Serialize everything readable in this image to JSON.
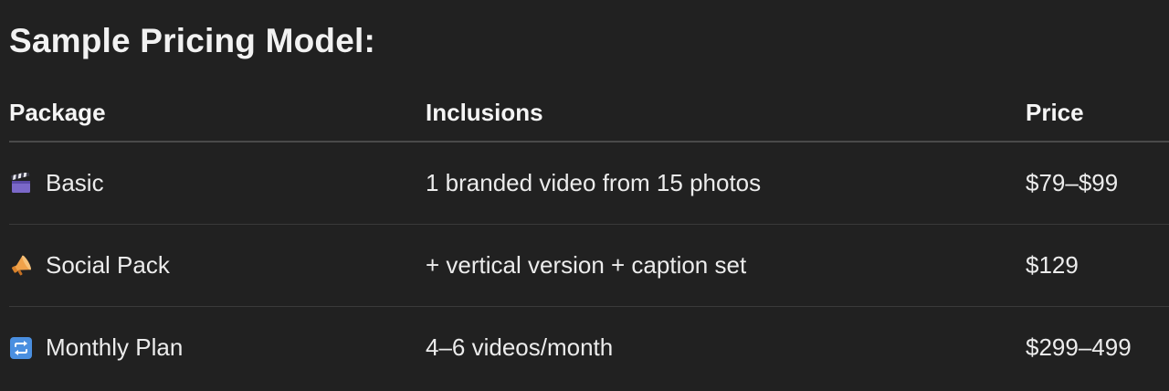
{
  "heading": "Sample Pricing Model:",
  "table": {
    "headers": [
      "Package",
      "Inclusions",
      "Price"
    ],
    "rows": [
      {
        "icon": "clapper-board-icon",
        "package": "Basic",
        "inclusions": "1 branded video from 15 photos",
        "price": "$79–$99"
      },
      {
        "icon": "megaphone-icon",
        "package": "Social Pack",
        "inclusions": "+ vertical version + caption set",
        "price": "$129"
      },
      {
        "icon": "repeat-icon",
        "package": "Monthly Plan",
        "inclusions": "4–6 videos/month",
        "price": "$299–499"
      }
    ]
  },
  "colors": {
    "background": "#212121",
    "text": "#ececec",
    "divider": "#3a3a3a"
  }
}
